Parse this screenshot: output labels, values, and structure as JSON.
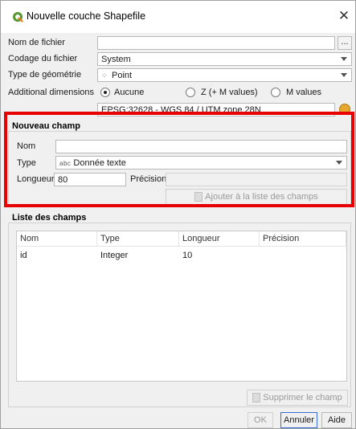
{
  "title": "Nouvelle couche Shapefile",
  "fields": {
    "file_name_label": "Nom de fichier",
    "file_name_value": "",
    "browse_label": "...",
    "encoding_label": "Codage du fichier",
    "encoding_value": "System",
    "geometry_label": "Type de géométrie",
    "geometry_value": "Point",
    "dimensions_label": "Additional dimensions",
    "dim_options": [
      "Aucune",
      "Z (+ M values)",
      "M values"
    ],
    "dim_selected": "Aucune",
    "crs_value": "EPSG:32628 - WGS 84 / UTM zone 28N"
  },
  "new_field": {
    "title": "Nouveau champ",
    "name_label": "Nom",
    "name_value": "",
    "type_label": "Type",
    "type_icon": "abc",
    "type_value": "Donnée texte",
    "length_label": "Longueur",
    "length_value": "80",
    "precision_label": "Précision",
    "precision_value": "",
    "add_button": "Ajouter à la liste des champs"
  },
  "field_list": {
    "title": "Liste des champs",
    "columns": [
      "Nom",
      "Type",
      "Longueur",
      "Précision"
    ],
    "rows": [
      {
        "name": "id",
        "type": "Integer",
        "length": "10",
        "precision": ""
      }
    ],
    "remove_button": "Supprimer le champ"
  },
  "footer": {
    "ok": "OK",
    "cancel": "Annuler",
    "help": "Aide"
  },
  "colors": {
    "highlight": "#e80000",
    "qgis_green": "#589632",
    "default_button_border": "#3b6dd8"
  },
  "icons": {
    "logo": "qgis-logo-icon",
    "close": "close-icon",
    "point": "point-geometry-icon",
    "crs": "crs-globe-icon"
  }
}
